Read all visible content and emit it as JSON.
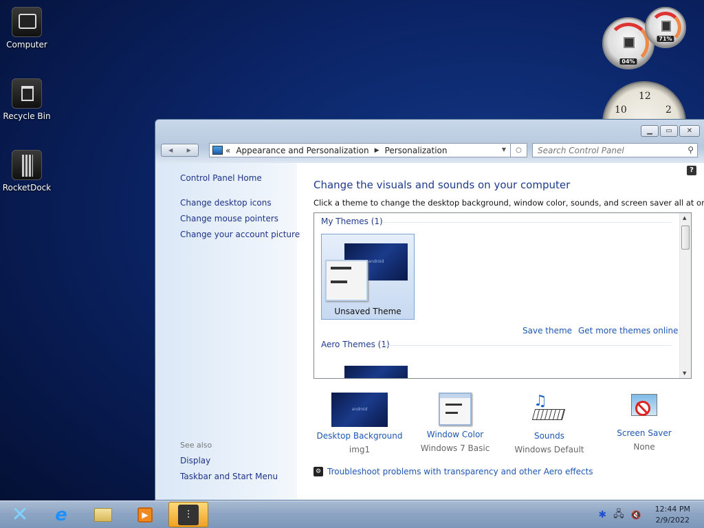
{
  "desktop": {
    "icons": [
      {
        "label": "Computer"
      },
      {
        "label": "Recycle Bin"
      },
      {
        "label": "RocketDock"
      }
    ],
    "gadgets": {
      "cpu_meter": {
        "cpu_value": "04%",
        "memory_value": "71%"
      },
      "clock": {
        "numerals": [
          "10",
          "12",
          "2"
        ]
      }
    }
  },
  "window": {
    "title_buttons": {
      "minimize": "minimize-icon",
      "maximize": "maximize-icon",
      "close": "close-icon"
    },
    "breadcrumb": {
      "overflow": "«",
      "items": [
        "Appearance and Personalization",
        "Personalization"
      ]
    },
    "search": {
      "placeholder": "Search Control Panel"
    },
    "help_label": "?",
    "left_pane": {
      "home": "Control Panel Home",
      "links": [
        "Change desktop icons",
        "Change mouse pointers",
        "Change your account picture"
      ],
      "see_also_label": "See also",
      "see_also": [
        "Display",
        "Taskbar and Start Menu"
      ]
    },
    "main": {
      "title": "Change the visuals and sounds on your computer",
      "description": "Click a theme to change the desktop background, window color, sounds, and screen saver all at once.",
      "groups": [
        {
          "header": "My Themes (1)",
          "themes": [
            {
              "name": "Unsaved Theme",
              "thumb_text": "android"
            }
          ]
        },
        {
          "header": "Aero Themes (1)"
        }
      ],
      "save_theme": "Save theme",
      "get_more": "Get more themes online",
      "settings": [
        {
          "label": "Desktop Background",
          "value": "img1",
          "thumb_text": "android"
        },
        {
          "label": "Window Color",
          "value": "Windows 7 Basic"
        },
        {
          "label": "Sounds",
          "value": "Windows Default"
        },
        {
          "label": "Screen Saver",
          "value": "None"
        }
      ],
      "troubleshoot": "Troubleshoot problems with transparency and other Aero effects"
    }
  },
  "taskbar": {
    "clock": {
      "time": "12:44 PM",
      "date": "2/9/2022"
    }
  },
  "colors": {
    "link": "#1e56b3",
    "heading": "#1e3a8c",
    "active_task": "#f0a21e"
  }
}
